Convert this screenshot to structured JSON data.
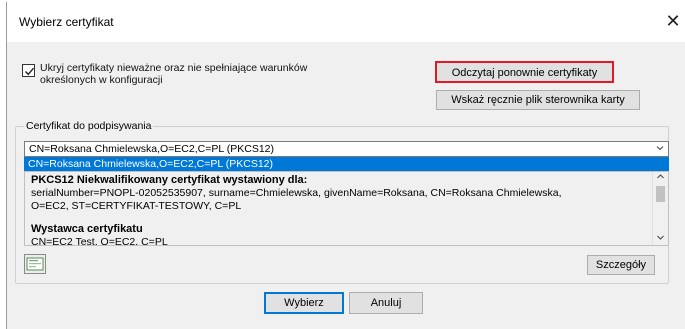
{
  "window": {
    "title": "Wybierz certyfikat",
    "close_glyph": "✕"
  },
  "options": {
    "hide_invalid_checked": true,
    "hide_invalid_label": "Ukryj certyfikaty nieważne oraz nie spełniające warunków określonych w konfiguracji"
  },
  "buttons": {
    "reload": "Odczytaj ponownie certyfikaty",
    "manual_driver": "Wskaż ręcznie plik sterownika karty",
    "details": "Szczegóły",
    "ok": "Wybierz",
    "cancel": "Anuluj"
  },
  "signing_group": {
    "label": "Certyfikat do podpisywania",
    "selected": "CN=Roksana Chmielewska,O=EC2,C=PL (PKCS12)",
    "highlighted_option": "CN=Roksana Chmielewska,O=EC2,C=PL (PKCS12)"
  },
  "details": {
    "issued_to_heading": "PKCS12 Niekwalifikowany certyfikat wystawiony dla:",
    "issued_to_line1": "serialNumber=PNOPL-02052535907, surname=Chmielewska, givenName=Roksana, CN=Roksana Chmielewska,",
    "issued_to_line2": "O=EC2, ST=CERTYFIKAT-TESTOWY, C=PL",
    "issuer_heading": "Wystawca certyfikatu",
    "issuer_line1": "CN=EC2 Test, O=EC2, C=PL"
  },
  "icons": {
    "check": "checkmark-icon",
    "dropdown": "chevron-down-icon",
    "scroll_up": "scroll-up-icon",
    "scroll_down": "scroll-down-icon",
    "certificate": "certificate-icon"
  },
  "colors": {
    "highlight_border": "#e01b24",
    "selection_bg": "#0078d7",
    "focus_border": "#0078d7"
  }
}
